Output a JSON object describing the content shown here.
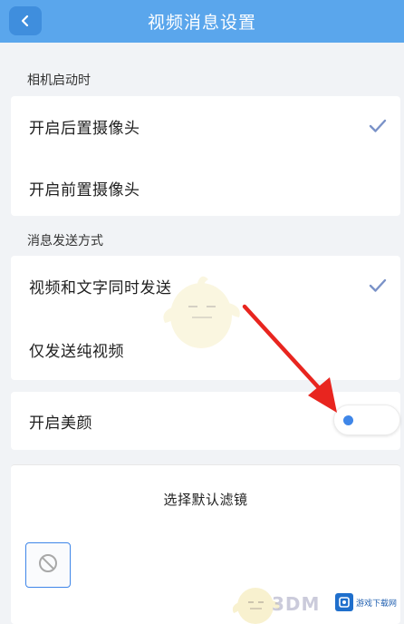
{
  "header": {
    "title": "视频消息设置",
    "back_icon": "chevron-left-icon"
  },
  "camera_section": {
    "label": "相机启动时",
    "options": [
      {
        "label": "开启后置摄像头",
        "selected": true
      },
      {
        "label": "开启前置摄像头",
        "selected": false
      }
    ]
  },
  "send_section": {
    "label": "消息发送方式",
    "options": [
      {
        "label": "视频和文字同时发送",
        "selected": true
      },
      {
        "label": "仅发送纯视频",
        "selected": false
      }
    ]
  },
  "beauty": {
    "label": "开启美颜",
    "enabled": false
  },
  "filter": {
    "title": "选择默认滤镜",
    "selected_icon": "no-filter-icon"
  },
  "watermarks": {
    "brand": "3DM",
    "site": "游戏下载网"
  },
  "colors": {
    "header_bg": "#5aa6ec",
    "accent": "#3f86e8",
    "annotation_arrow": "#e8251f",
    "check": "#7a92c8"
  }
}
